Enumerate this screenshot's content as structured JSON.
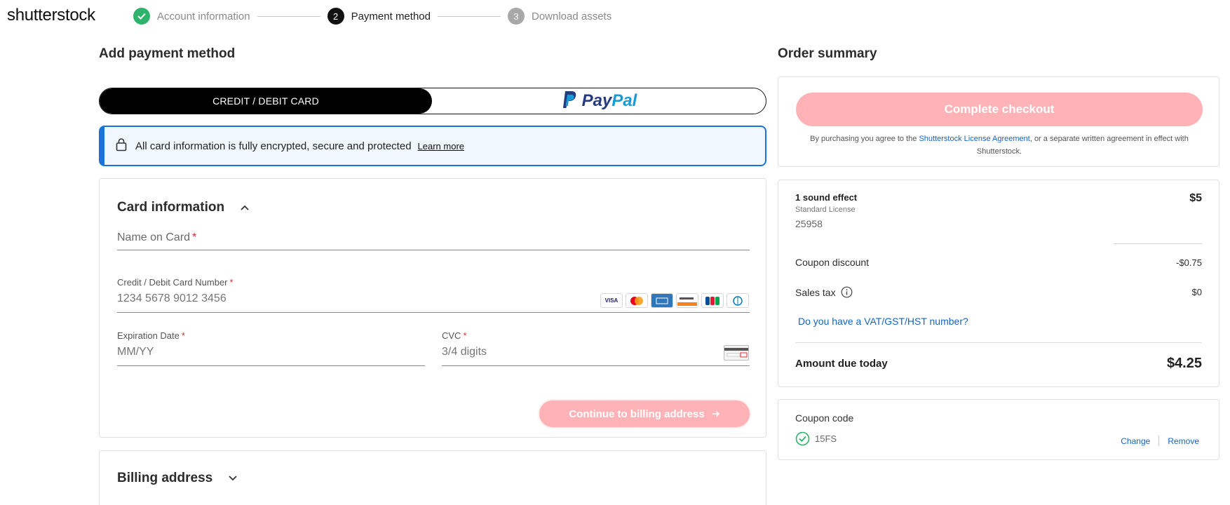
{
  "brand": {
    "logo_text": "shutterstock"
  },
  "steps": [
    {
      "number": "1",
      "label": "Account information",
      "state": "done",
      "color": "#2fb26b"
    },
    {
      "number": "2",
      "label": "Payment method",
      "state": "active",
      "color": "#111111"
    },
    {
      "number": "3",
      "label": "Download assets",
      "state": "pending",
      "color": "#a8a8a8"
    }
  ],
  "payment": {
    "heading": "Add payment method",
    "tabs": {
      "card_label": "CREDIT / DEBIT CARD",
      "paypal_pay": "Pay",
      "paypal_pal": "Pal"
    },
    "secure_banner": {
      "text": "All card information is fully encrypted, secure and protected",
      "link": "Learn more"
    },
    "card_section": {
      "title": "Card information",
      "name_placeholder": "Name on Card",
      "number_label": "Credit / Debit Card Number",
      "number_placeholder": "1234 5678 9012 3456",
      "expiry_label": "Expiration Date",
      "expiry_placeholder": "MM/YY",
      "cvc_label": "CVC",
      "cvc_placeholder": "3/4 digits",
      "required_mark": "*",
      "card_brands": [
        "visa",
        "mastercard",
        "amex",
        "discover",
        "jcb",
        "diners"
      ],
      "continue_label": "Continue to billing address"
    },
    "billing_section": {
      "title": "Billing address"
    }
  },
  "order": {
    "heading": "Order summary",
    "checkout_label": "Complete checkout",
    "agreement_prefix": "By purchasing you agree to the ",
    "agreement_link": "Shutterstock License Agreement",
    "agreement_suffix": ", or a separate written agreement in effect with Shutterstock.",
    "item": {
      "title": "1 sound effect",
      "license": "Standard License",
      "id": "25958",
      "price": "$5"
    },
    "coupon_discount": {
      "label": "Coupon discount",
      "value": "-$0.75"
    },
    "sales_tax": {
      "label": "Sales tax",
      "value": "$0"
    },
    "vat_link": "Do you have a VAT/GST/HST number?",
    "amount_due": {
      "label": "Amount due today",
      "value": "$4.25"
    },
    "coupon": {
      "label": "Coupon code",
      "code": "15FS",
      "change": "Change",
      "remove": "Remove"
    }
  },
  "colors": {
    "accent_pink": "#ffb3b6",
    "link_blue": "#1565c0",
    "banner_blue": "#1a73d9",
    "success_green": "#2fb26b"
  }
}
